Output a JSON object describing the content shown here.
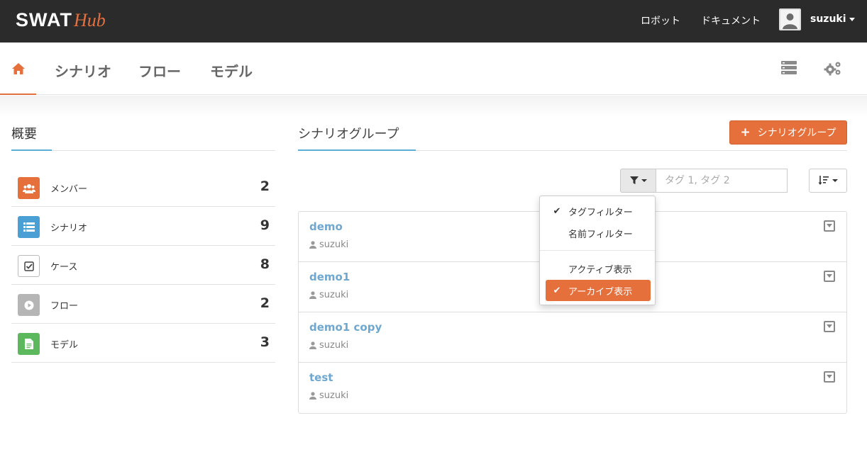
{
  "topbar": {
    "logo_main": "SWAT",
    "logo_sub": "Hub",
    "links": [
      "ロボット",
      "ドキュメント"
    ],
    "user": "suzuki"
  },
  "nav": {
    "tabs": [
      "シナリオ",
      "フロー",
      "モデル"
    ]
  },
  "overview": {
    "title": "概要",
    "stats": [
      {
        "label": "メンバー",
        "count": "2",
        "icon": "users-icon",
        "color": "#e5703c"
      },
      {
        "label": "シナリオ",
        "count": "9",
        "icon": "list-icon",
        "color": "#4a9fd5"
      },
      {
        "label": "ケース",
        "count": "8",
        "icon": "checkbox-icon",
        "color": "#ffffff"
      },
      {
        "label": "フロー",
        "count": "2",
        "icon": "play-icon",
        "color": "#b5b5b5"
      },
      {
        "label": "モデル",
        "count": "3",
        "icon": "document-icon",
        "color": "#5cb85c"
      }
    ]
  },
  "groups": {
    "title": "シナリオグループ",
    "add_label": "シナリオグループ",
    "tag_placeholder": "タグ 1, タグ 2",
    "items": [
      {
        "name": "demo",
        "owner": "suzuki"
      },
      {
        "name": "demo1",
        "owner": "suzuki"
      },
      {
        "name": "demo1 copy",
        "owner": "suzuki"
      },
      {
        "name": "test",
        "owner": "suzuki"
      }
    ]
  },
  "filter_menu": {
    "items": [
      {
        "label": "タグフィルター",
        "checked": true
      },
      {
        "label": "名前フィルター",
        "checked": false
      },
      {
        "label": "アクティブ表示",
        "checked": false
      },
      {
        "label": "アーカイブ表示",
        "checked": true
      }
    ]
  },
  "colors": {
    "accent": "#e5703c",
    "link": "#6ea7cf",
    "topbar": "#2b2b2b"
  }
}
